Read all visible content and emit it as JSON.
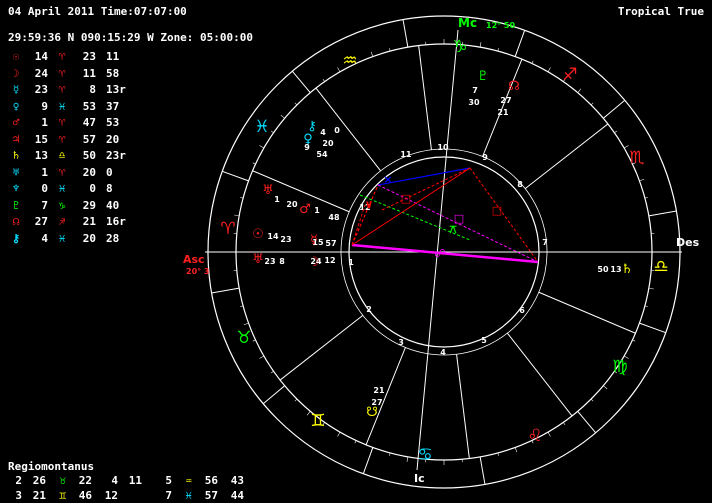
{
  "header": {
    "datetime": "04 April 2011 Time:07:07:00",
    "zodiac": "Tropical True",
    "coords": "29:59:36 N 090:15:29 W Zone: 05:00:00"
  },
  "colors": {
    "sun": "#ff2020",
    "moon": "#ff2020",
    "mercury": "#00e0ff",
    "venus": "#00e0ff",
    "mars": "#ff2020",
    "jupiter": "#ff2020",
    "saturn": "#ffff00",
    "uranus": "#00e0ff",
    "neptune": "#00e0ff",
    "pluto": "#00ff00",
    "node": "#ff2020",
    "chiron": "#00e0ff",
    "wheel": "#ffffff",
    "axis_label": "#ff2020",
    "mc_label": "#00ff00"
  },
  "planets": [
    {
      "name": "sun",
      "glyph": "☉",
      "deg": "14",
      "sign": "♈",
      "min": "23",
      "extra": "11"
    },
    {
      "name": "moon",
      "glyph": "☽",
      "deg": "24",
      "sign": "♈",
      "min": "11",
      "extra": "58"
    },
    {
      "name": "mercury",
      "glyph": "☿",
      "deg": "23",
      "sign": "♈",
      "min": "8",
      "extra": "13r"
    },
    {
      "name": "venus",
      "glyph": "♀",
      "deg": "9",
      "sign": "♓",
      "min": "53",
      "extra": "37"
    },
    {
      "name": "mars",
      "glyph": "♂",
      "deg": "1",
      "sign": "♈",
      "min": "47",
      "extra": "53"
    },
    {
      "name": "jupiter",
      "glyph": "♃",
      "deg": "15",
      "sign": "♈",
      "min": "57",
      "extra": "20"
    },
    {
      "name": "saturn",
      "glyph": "♄",
      "deg": "13",
      "sign": "♎",
      "min": "50",
      "extra": "23r"
    },
    {
      "name": "uranus",
      "glyph": "♅",
      "deg": "1",
      "sign": "♈",
      "min": "20",
      "extra": "0"
    },
    {
      "name": "neptune",
      "glyph": "♆",
      "deg": "0",
      "sign": "♓",
      "min": "0",
      "extra": "8"
    },
    {
      "name": "pluto",
      "glyph": "♇",
      "deg": "7",
      "sign": "♑",
      "min": "29",
      "extra": "40"
    },
    {
      "name": "node",
      "glyph": "☊",
      "deg": "27",
      "sign": "♐",
      "min": "21",
      "extra": "16r"
    },
    {
      "name": "chiron",
      "glyph": "⚷",
      "deg": "4",
      "sign": "♓",
      "min": "20",
      "extra": "28"
    }
  ],
  "houses": {
    "title": "Regiomontanus",
    "rows": [
      [
        {
          "h": "2",
          "d": "26",
          "s": "♉"
        },
        {
          "h": "22",
          "d": "4",
          "s": ""
        },
        {
          "h": "11",
          "d": "5",
          "s": "♒"
        },
        {
          "h": "56",
          "d": "43",
          "s": ""
        }
      ],
      [
        {
          "h": "3",
          "d": "21",
          "s": "♊"
        },
        {
          "h": "46",
          "d": "12",
          "s": ""
        },
        {
          "h": "7",
          "d": "♓",
          "s": ""
        },
        {
          "h": "57",
          "d": "44",
          "s": ""
        }
      ]
    ],
    "row_text": [
      {
        "a": "2",
        "b": "26",
        "sa": "♉",
        "c": "22",
        "d": "4",
        "e": "11",
        "f": "5",
        "sb": "♒",
        "g": "56",
        "h": "43"
      },
      {
        "a": "3",
        "b": "21",
        "sa": "♊",
        "c": "46",
        "d": "12",
        "e": "",
        "f": "7",
        "sb": "♓",
        "g": "57",
        "h": "44"
      }
    ]
  },
  "axes": {
    "mc": "Mc",
    "mc_deg": "12° 50",
    "asc": "Asc",
    "asc_deg": "20° 3",
    "des": "Des",
    "ic": "Ic"
  },
  "house_numbers": [
    "1",
    "2",
    "3",
    "4",
    "5",
    "6",
    "7",
    "8",
    "9",
    "10",
    "11",
    "12"
  ],
  "wheel_signs": [
    {
      "glyph": "♑",
      "name": "capricorn"
    },
    {
      "glyph": "♒",
      "name": "aquarius"
    },
    {
      "glyph": "♓",
      "name": "pisces"
    },
    {
      "glyph": "♈",
      "name": "aries"
    },
    {
      "glyph": "♉",
      "name": "taurus"
    },
    {
      "glyph": "♊",
      "name": "gemini"
    },
    {
      "glyph": "♋",
      "name": "cancer"
    },
    {
      "glyph": "♌",
      "name": "leo"
    },
    {
      "glyph": "♍",
      "name": "virgo"
    },
    {
      "glyph": "♎",
      "name": "libra"
    },
    {
      "glyph": "♏",
      "name": "scorpio"
    },
    {
      "glyph": "♐",
      "name": "sagittarius"
    }
  ],
  "chart_labels": {
    "pluto_deg": "7",
    "pluto_min": "30",
    "node_deg": "27",
    "node_min": "21",
    "chiron_deg": "4",
    "chiron_min": "20",
    "venus_deg": "9",
    "venus_min": "54",
    "uranus_deg": "1",
    "uranus_min": "20",
    "mars_deg": "1",
    "mars_min": "48",
    "sun_deg": "14",
    "sun_min": "23",
    "jupiter_deg": "15",
    "jupiter_min": "57",
    "mercury_deg": "23",
    "mercury_min": "8",
    "moon_deg": "24",
    "moon_min": "12",
    "saturn_min": "50",
    "saturn_deg": "13",
    "snode_deg": "21",
    "snode_min": "27",
    "chiron_extra": "0"
  }
}
